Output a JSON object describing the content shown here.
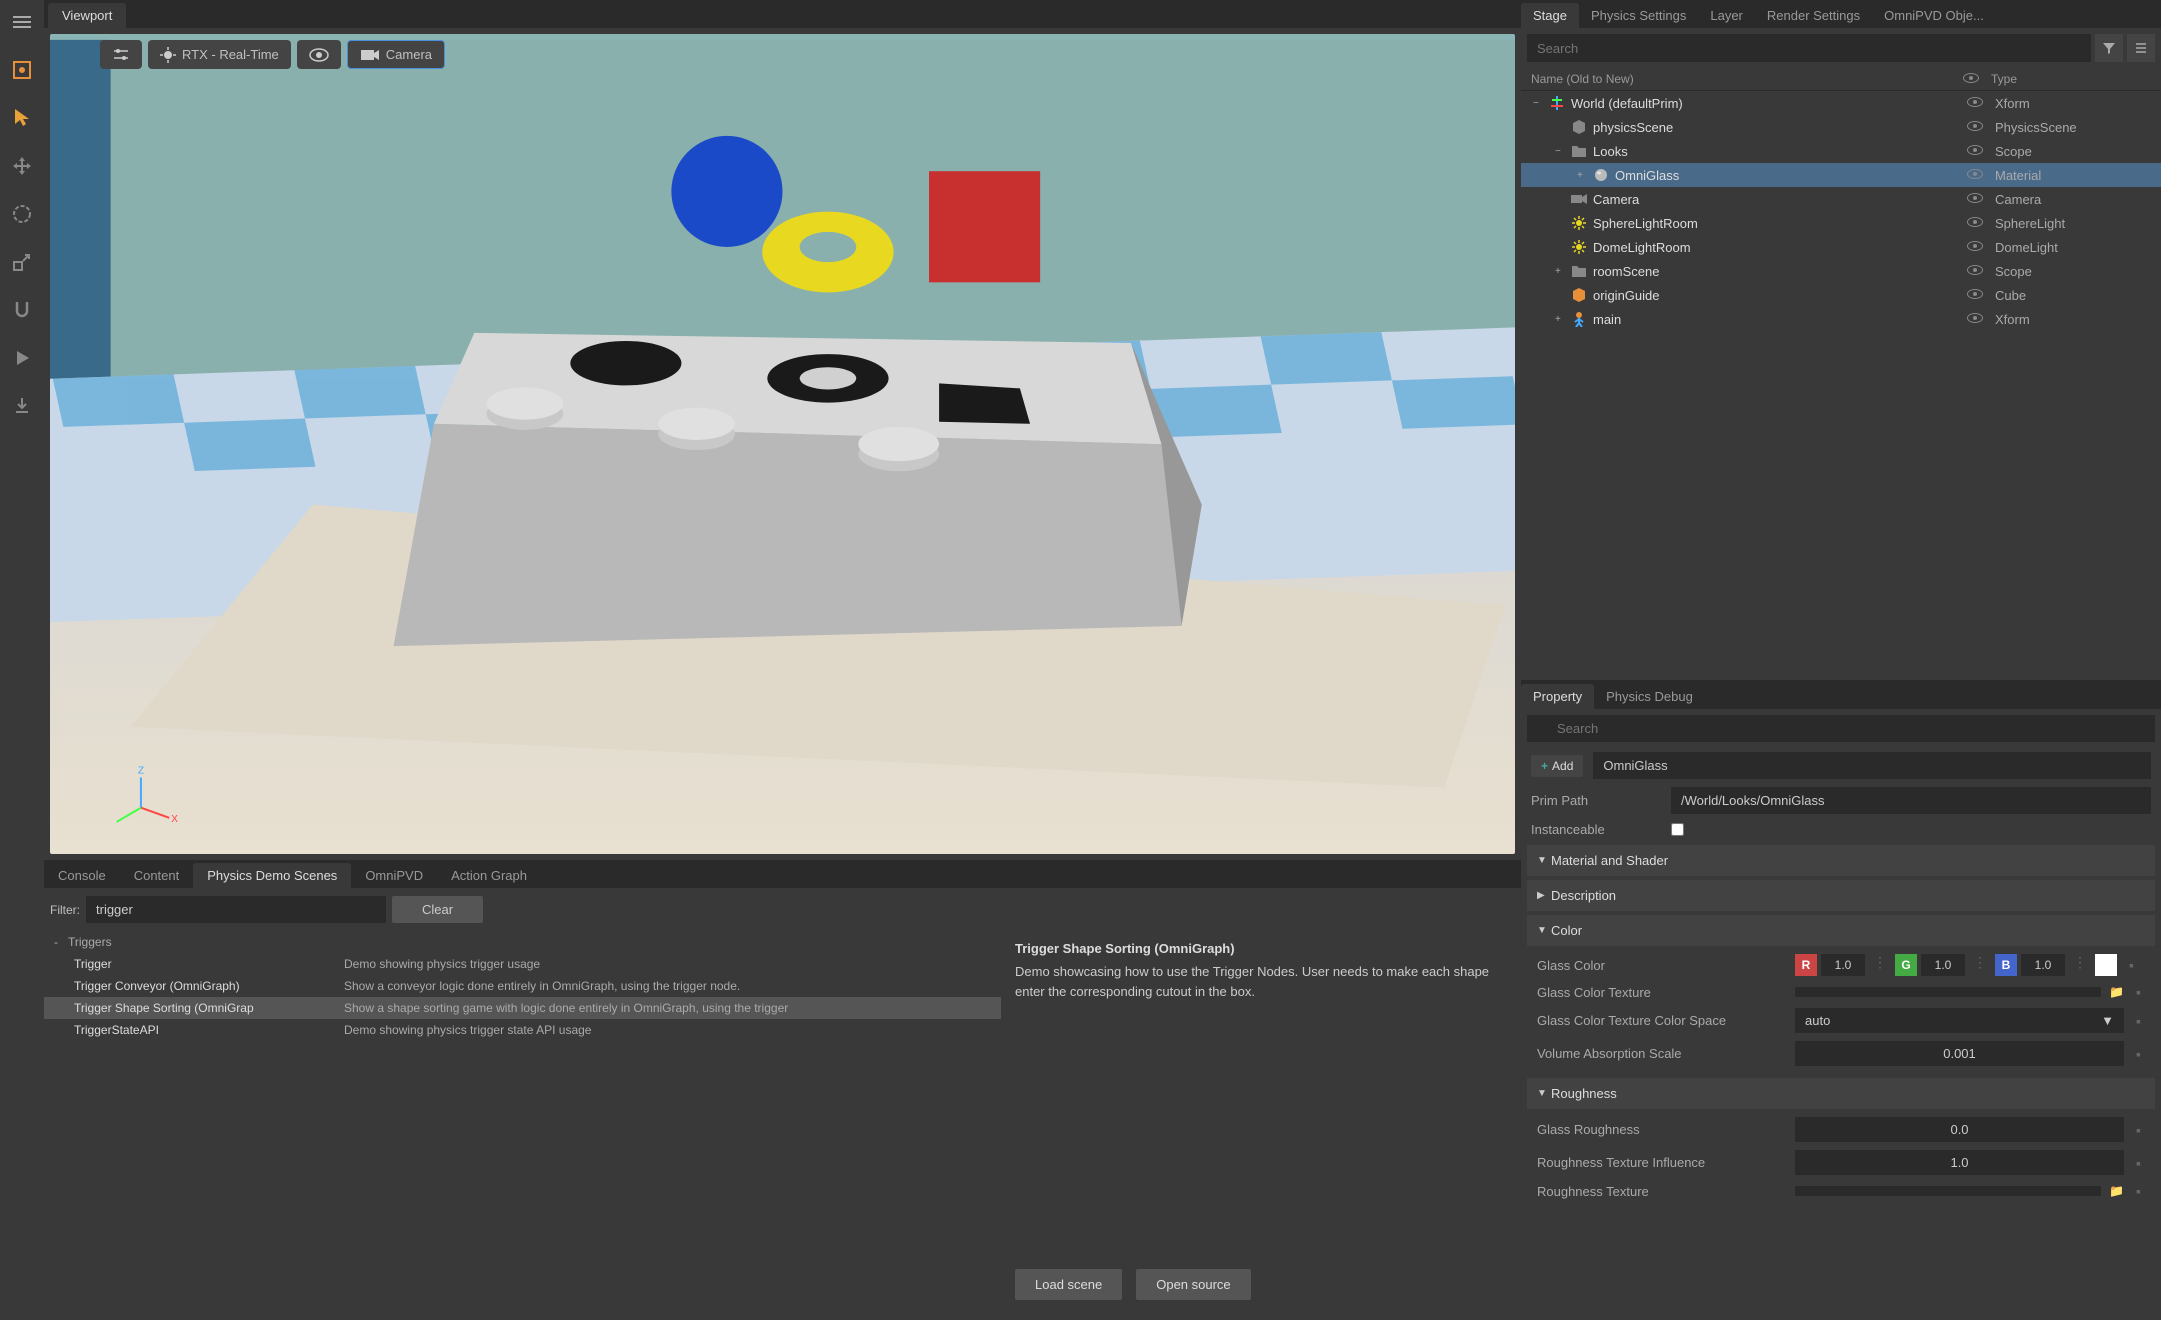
{
  "viewport": {
    "tab": "Viewport",
    "rtx": "RTX - Real-Time",
    "camera": "Camera"
  },
  "bottom_tabs": [
    "Console",
    "Content",
    "Physics Demo Scenes",
    "OmniPVD",
    "Action Graph"
  ],
  "bottom_active": 2,
  "filter": {
    "label": "Filter:",
    "value": "trigger",
    "clear": "Clear"
  },
  "demo_group": "Triggers",
  "demos": [
    {
      "name": "Trigger",
      "desc": "Demo showing physics trigger usage"
    },
    {
      "name": "Trigger Conveyor (OmniGraph)",
      "desc": "Show a conveyor logic done entirely in OmniGraph, using the trigger node."
    },
    {
      "name": "Trigger Shape Sorting (OmniGrap",
      "desc": "Show a shape sorting game with logic done entirely in OmniGraph, using the trigger"
    },
    {
      "name": "TriggerStateAPI",
      "desc": "Demo showing physics trigger state API usage"
    }
  ],
  "selected_demo": 2,
  "detail": {
    "title": "Trigger Shape Sorting (OmniGraph)",
    "body": "Demo showcasing how to use the Trigger Nodes. User needs to make each shape enter the corresponding cutout in the box.",
    "load": "Load scene",
    "open": "Open source"
  },
  "stage_tabs": [
    "Stage",
    "Physics Settings",
    "Layer",
    "Render Settings",
    "OmniPVD Obje..."
  ],
  "stage_active": 0,
  "search_placeholder": "Search",
  "tree_headers": {
    "name": "Name (Old to New)",
    "type": "Type"
  },
  "tree": [
    {
      "indent": 0,
      "expand": "−",
      "icon": "world",
      "label": "World (defaultPrim)",
      "type": "Xform"
    },
    {
      "indent": 1,
      "expand": "",
      "icon": "cube-gray",
      "label": "physicsScene",
      "type": "PhysicsScene"
    },
    {
      "indent": 1,
      "expand": "−",
      "icon": "folder",
      "label": "Looks",
      "type": "Scope"
    },
    {
      "indent": 2,
      "expand": "+",
      "icon": "sphere",
      "label": "OmniGlass",
      "type": "Material",
      "selected": true
    },
    {
      "indent": 1,
      "expand": "",
      "icon": "camera",
      "label": "Camera",
      "type": "Camera"
    },
    {
      "indent": 1,
      "expand": "",
      "icon": "light",
      "label": "SphereLightRoom",
      "type": "SphereLight"
    },
    {
      "indent": 1,
      "expand": "",
      "icon": "light",
      "label": "DomeLightRoom",
      "type": "DomeLight"
    },
    {
      "indent": 1,
      "expand": "+",
      "icon": "folder",
      "label": "roomScene",
      "type": "Scope"
    },
    {
      "indent": 1,
      "expand": "",
      "icon": "cube-orange",
      "label": "originGuide",
      "type": "Cube"
    },
    {
      "indent": 1,
      "expand": "+",
      "icon": "person",
      "label": "main",
      "type": "Xform"
    }
  ],
  "prop_tabs": [
    "Property",
    "Physics Debug"
  ],
  "prop_active": 0,
  "prop_search_placeholder": "Search",
  "add_label": "Add",
  "prim_name": "OmniGlass",
  "prim_path_label": "Prim Path",
  "prim_path": "/World/Looks/OmniGlass",
  "instanceable_label": "Instanceable",
  "sections": {
    "mat_shader": "Material and Shader",
    "description": "Description",
    "color": "Color",
    "roughness": "Roughness"
  },
  "color": {
    "glass_color_label": "Glass Color",
    "r": "1.0",
    "g": "1.0",
    "b": "1.0",
    "texture_label": "Glass Color Texture",
    "cspace_label": "Glass Color Texture Color Space",
    "cspace_val": "auto",
    "vol_label": "Volume Absorption Scale",
    "vol_val": "0.001"
  },
  "roughness": {
    "gr_label": "Glass Roughness",
    "gr_val": "0.0",
    "ti_label": "Roughness Texture Influence",
    "ti_val": "1.0",
    "tex_label": "Roughness Texture"
  }
}
